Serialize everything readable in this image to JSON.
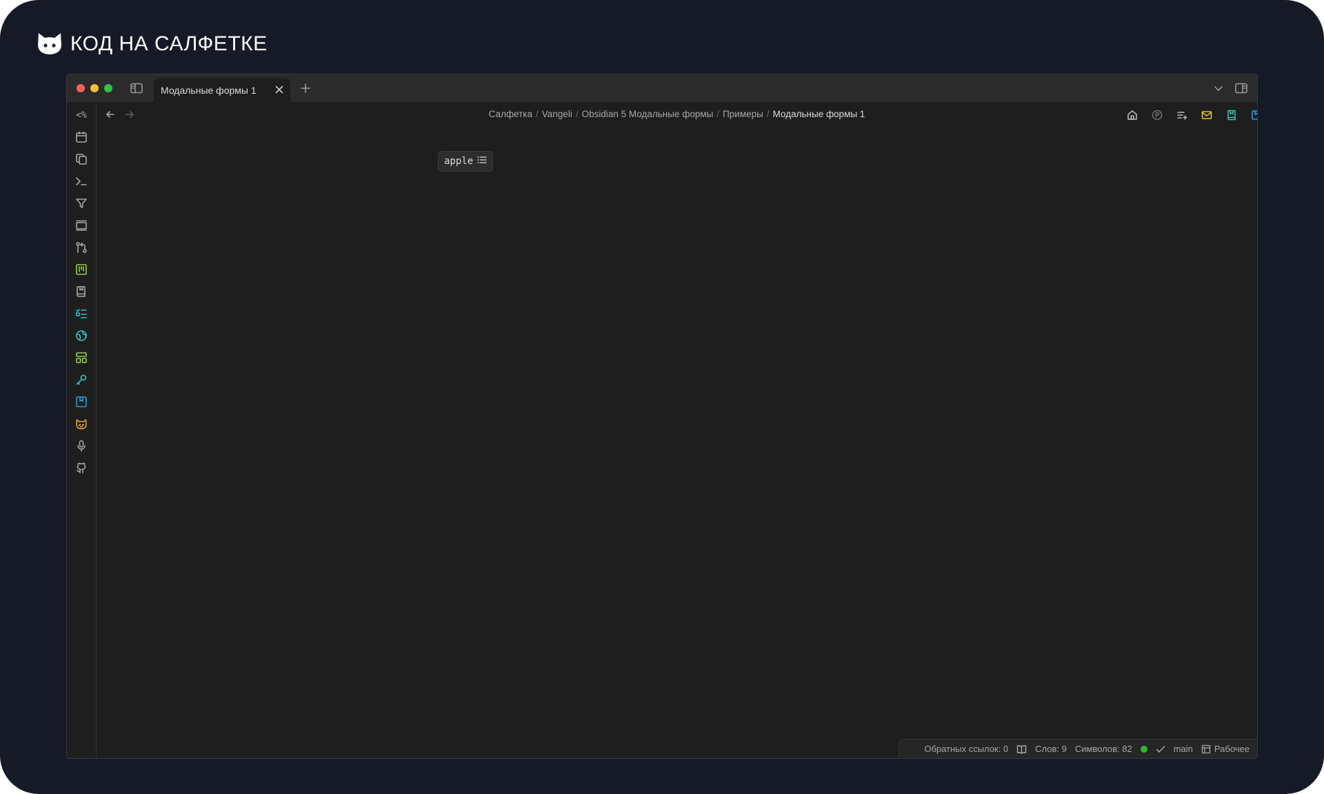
{
  "brand": {
    "text": "КОД НА САЛФЕТКЕ",
    "logo_icon": "cat-face-icon"
  },
  "window": {
    "tab": {
      "label": "Модальные формы 1"
    },
    "breadcrumbs": [
      "Салфетка",
      "Vangeli",
      "Obsidian 5 Модальные формы",
      "Примеры",
      "Модальные формы 1"
    ],
    "ribbon": {
      "first_label": "<%",
      "icons": [
        {
          "name": "calendar-icon",
          "color": "#a8a8a8"
        },
        {
          "name": "copy-icon",
          "color": "#a8a8a8"
        },
        {
          "name": "terminal-icon",
          "color": "#a8a8a8"
        },
        {
          "name": "filter-icon",
          "color": "#a8a8a8"
        },
        {
          "name": "slides-icon",
          "color": "#a8a8a8"
        },
        {
          "name": "git-compare-icon",
          "color": "#a8a8a8"
        },
        {
          "name": "kanban-icon",
          "color": "#9bd13c"
        },
        {
          "name": "book-icon",
          "color": "#a8a8a8"
        },
        {
          "name": "checklist-icon",
          "color": "#2fc3c3"
        },
        {
          "name": "globe-icon",
          "color": "#2fc3c3"
        },
        {
          "name": "layout-icon",
          "color": "#9bd13c"
        },
        {
          "name": "key-icon",
          "color": "#2fc3c3"
        },
        {
          "name": "bookmark-box-icon",
          "color": "#2d9cdb"
        },
        {
          "name": "cat-icon",
          "color": "#e0a23c"
        },
        {
          "name": "microphone-icon",
          "color": "#a8a8a8"
        },
        {
          "name": "github-icon",
          "color": "#a8a8a8"
        }
      ]
    },
    "actions": [
      {
        "name": "home-icon",
        "color": "#bdbdbd"
      },
      {
        "name": "coin-icon",
        "color": "#6c6c6c"
      },
      {
        "name": "list-add-icon",
        "color": "#bdbdbd"
      },
      {
        "name": "mail-icon",
        "color": "#e2c53b"
      },
      {
        "name": "bookmark-green-icon",
        "color": "#2fc3a3"
      },
      {
        "name": "bookmark-blue-icon",
        "color": "#2d9cdb"
      },
      {
        "name": "pencil-icon",
        "color": "#bdbdbd"
      },
      {
        "name": "more-icon",
        "color": "#bdbdbd"
      }
    ],
    "content": {
      "tag": "apple"
    },
    "status": {
      "backlinks": "Обратных ссылок: 0",
      "words": "Слов: 9",
      "chars": "Символов: 82",
      "branch": "main",
      "workspace": "Рабочее",
      "sync_color": "#2eb82e"
    }
  }
}
